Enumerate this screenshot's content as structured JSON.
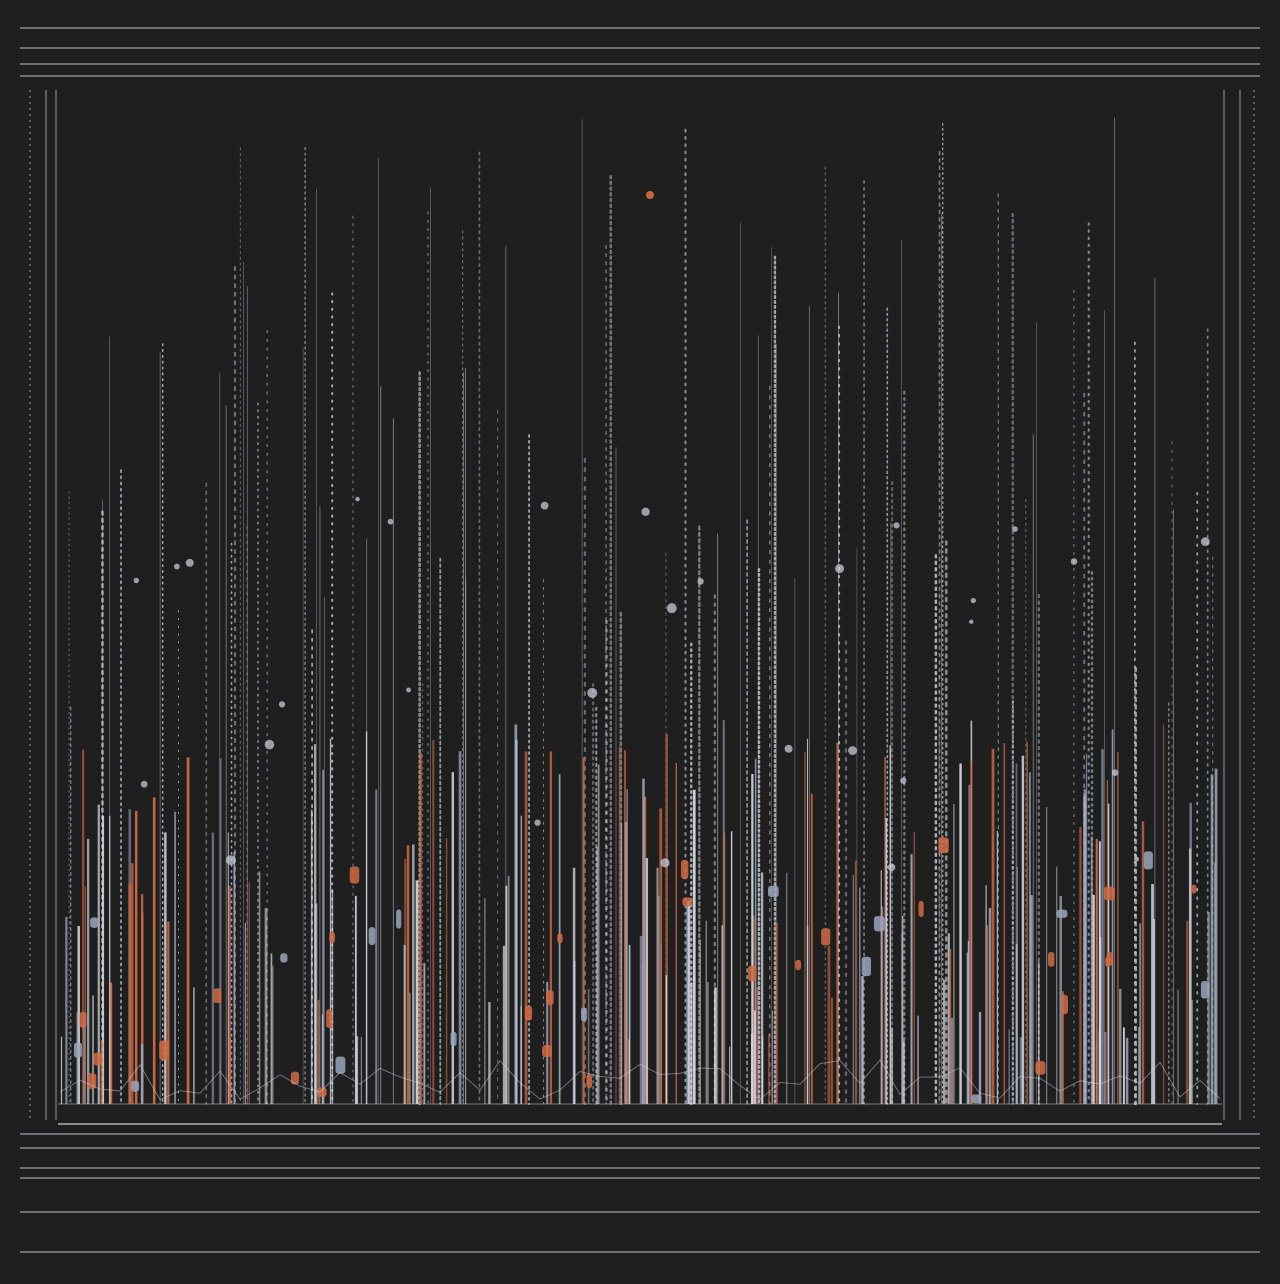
{
  "colors": {
    "background": "#1f1f20",
    "frame": "#c9ccd2",
    "white_series": "#d4d8df",
    "blue_series": "#9aa6bd",
    "orange_series": "#d06b44",
    "dotted_series": "#c6ccd6",
    "text": "#bfc2c8"
  },
  "artwork": {
    "kind": "decorative-abstract-chart-artwork",
    "style": "dense vertical lines and dotted columns with orange accents on a dark background",
    "legible_text": false
  },
  "decorative_text": {
    "top_band": "",
    "bottom_band_1": "",
    "bottom_band_2": "",
    "bottom_band_3": ""
  },
  "icons": [
    "none"
  ]
}
